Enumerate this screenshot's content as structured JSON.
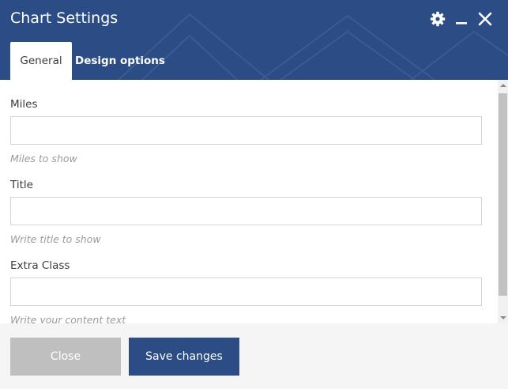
{
  "dialog": {
    "title": "Chart Settings",
    "icons": {
      "settings": "gear-icon",
      "minimize": "minimize-icon",
      "close": "close-icon"
    }
  },
  "tabs": [
    {
      "label": "General",
      "active": true
    },
    {
      "label": "Design options",
      "active": false
    }
  ],
  "fields": [
    {
      "label": "Miles",
      "value": "",
      "help": "Miles to show"
    },
    {
      "label": "Title",
      "value": "",
      "help": "Write title to show"
    },
    {
      "label": "Extra Class",
      "value": "",
      "help": "Write your content text"
    }
  ],
  "footer": {
    "close_label": "Close",
    "save_label": "Save changes"
  },
  "colors": {
    "header": "#2b4c84",
    "primary_button": "#2b4c84",
    "secondary_button": "#bfbfbf"
  }
}
